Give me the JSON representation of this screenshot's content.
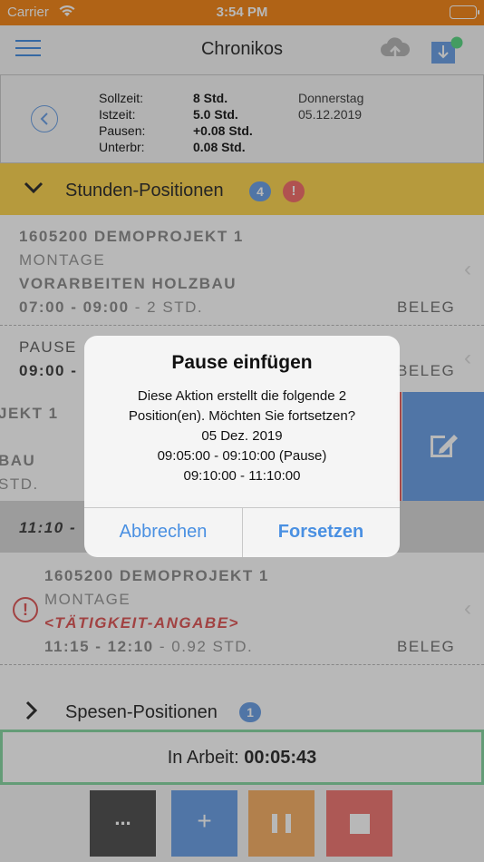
{
  "status_bar": {
    "carrier": "Carrier",
    "time": "3:54 PM"
  },
  "nav": {
    "title": "Chronikos"
  },
  "summary": {
    "rows": [
      {
        "label": "Sollzeit:",
        "value": "8 Std."
      },
      {
        "label": "Istzeit:",
        "value": "5.0 Std."
      },
      {
        "label": "Pausen:",
        "value": "+0.08 Std."
      },
      {
        "label": "Unterbr:",
        "value": "0.08 Std."
      }
    ],
    "weekday": "Donnerstag",
    "date": "05.12.2019"
  },
  "stunden": {
    "title": "Stunden-Positionen",
    "count": "4",
    "alert": "!"
  },
  "entries": {
    "e1": {
      "project": "1605200 DEMOPROJEKT 1",
      "type": "MONTAGE",
      "activity": "VORARBEITEN HOLZBAU",
      "time": "07:00 - 09:00",
      "duration": " - 2 STD.",
      "beleg": "BELEG"
    },
    "e2": {
      "type": "PAUSE",
      "time": "09:00 -",
      "beleg": "BELEG"
    },
    "e3": {
      "project_fragment": "JEKT 1",
      "activity_fragment": "BAU",
      "duration_fragment": "STD."
    },
    "e4": {
      "time": "11:10 -"
    },
    "e5": {
      "project": "1605200 DEMOPROJEKT 1",
      "type": "MONTAGE",
      "activity": "<TÄTIGKEIT-ANGABE>",
      "time": "11:15 - 12:10",
      "duration": " - 0.92 STD.",
      "beleg": "BELEG",
      "error": "!"
    }
  },
  "spesen": {
    "title": "Spesen-Positionen",
    "count": "1"
  },
  "work": {
    "label": "In Arbeit:",
    "timer": "00:05:43"
  },
  "toolbar": {
    "more": "...",
    "add": "+"
  },
  "alert": {
    "title": "Pause einfügen",
    "lines": [
      "Diese Aktion erstellt die folgende 2",
      "Position(en). Möchten Sie fortsetzen?",
      "05 Dez. 2019",
      "09:05:00 - 09:10:00 (Pause)",
      "09:10:00 - 11:10:00"
    ],
    "cancel": "Abbrechen",
    "confirm": "Forsetzen"
  },
  "colors": {
    "status_bar": "#f4891f",
    "section_header": "#fdd655",
    "accent_blue": "#6fa3e6",
    "pause_orange": "#f7b26a",
    "stop_red": "#f07a77",
    "work_border": "#8bd8a6"
  }
}
